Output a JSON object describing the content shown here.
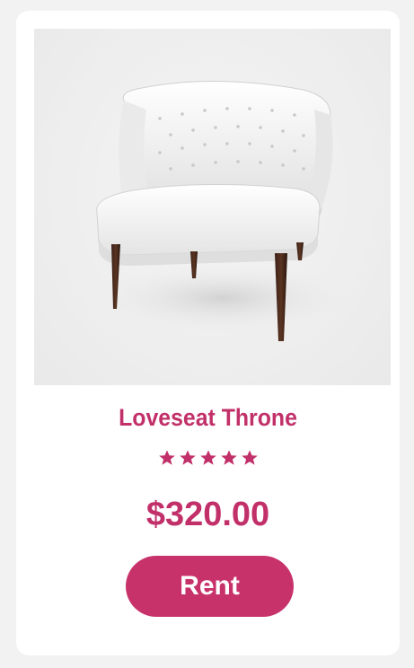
{
  "product": {
    "title": "Loveseat Throne",
    "rating": 5,
    "rating_max": 5,
    "price": "$320.00",
    "image_icon": "armchair-image"
  },
  "actions": {
    "rent_label": "Rent"
  },
  "colors": {
    "accent": "#c2306a",
    "button": "#c8326b",
    "page_background": "#f2f2f2",
    "card_background": "#ffffff"
  }
}
